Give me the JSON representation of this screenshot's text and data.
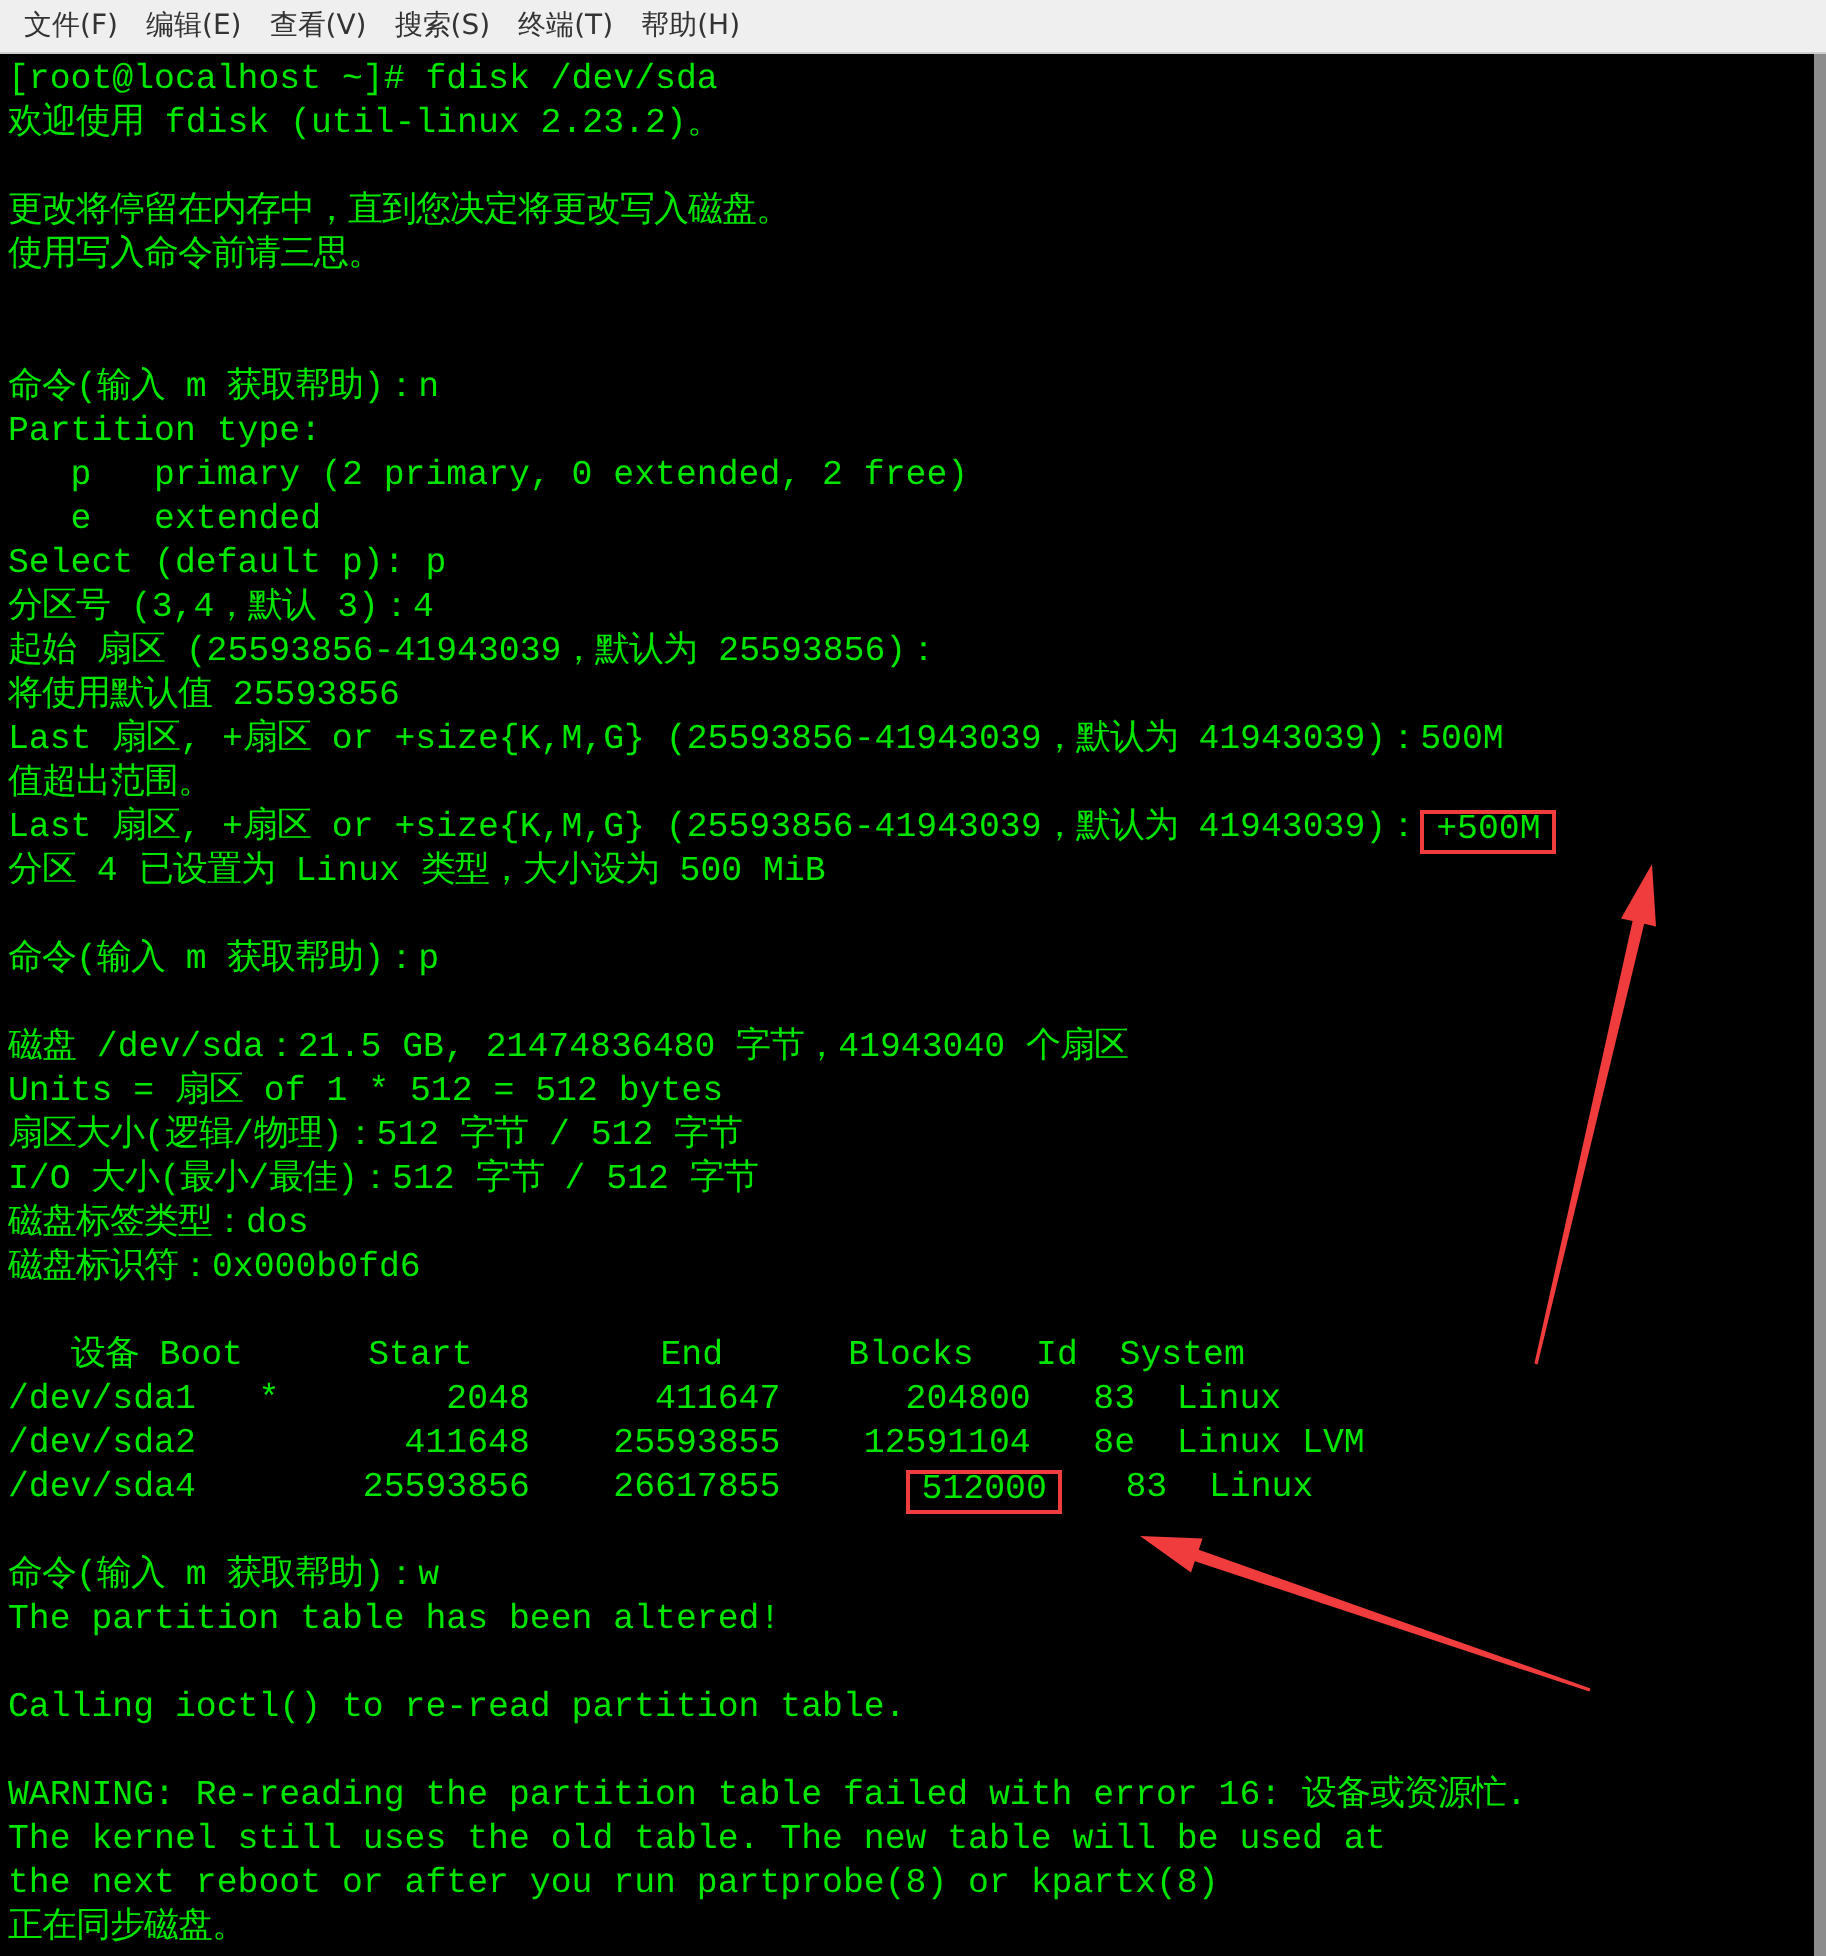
{
  "menu_bar": [
    "文件(F)",
    "编辑(E)",
    "查看(V)",
    "搜索(S)",
    "终端(T)",
    "帮助(H)"
  ],
  "terminal": {
    "lines": [
      {
        "kind": "text",
        "text": "[root@localhost ~]# fdisk /dev/sda"
      },
      {
        "kind": "text",
        "text": "欢迎使用 fdisk (util-linux 2.23.2)。"
      },
      {
        "kind": "blank"
      },
      {
        "kind": "text",
        "text": "更改将停留在内存中，直到您决定将更改写入磁盘。"
      },
      {
        "kind": "text",
        "text": "使用写入命令前请三思。"
      },
      {
        "kind": "blank"
      },
      {
        "kind": "blank"
      },
      {
        "kind": "text",
        "text": "命令(输入 m 获取帮助)：n"
      },
      {
        "kind": "text",
        "text": "Partition type:"
      },
      {
        "kind": "text",
        "text": "   p   primary (2 primary, 0 extended, 2 free)"
      },
      {
        "kind": "text",
        "text": "   e   extended"
      },
      {
        "kind": "text",
        "text": "Select (default p): p"
      },
      {
        "kind": "text",
        "text": "分区号 (3,4，默认 3)：4"
      },
      {
        "kind": "text",
        "text": "起始 扇区 (25593856-41943039，默认为 25593856)："
      },
      {
        "kind": "text",
        "text": "将使用默认值 25593856"
      },
      {
        "kind": "text",
        "text": "Last 扇区, +扇区 or +size{K,M,G} (25593856-41943039，默认为 41943039)：500M"
      },
      {
        "kind": "text",
        "text": "值超出范围。"
      },
      {
        "kind": "segmented",
        "segments": [
          {
            "text": "Last 扇区, +扇区 or +size{K,M,G} (25593856-41943039，默认为 41943039)：",
            "boxed": false
          },
          {
            "text": "+500M",
            "boxed": true
          }
        ]
      },
      {
        "kind": "text",
        "text": "分区 4 已设置为 Linux 类型，大小设为 500 MiB"
      },
      {
        "kind": "blank"
      },
      {
        "kind": "text",
        "text": "命令(输入 m 获取帮助)：p"
      },
      {
        "kind": "blank"
      },
      {
        "kind": "text",
        "text": "磁盘 /dev/sda：21.5 GB, 21474836480 字节，41943040 个扇区"
      },
      {
        "kind": "text",
        "text": "Units = 扇区 of 1 * 512 = 512 bytes"
      },
      {
        "kind": "text",
        "text": "扇区大小(逻辑/物理)：512 字节 / 512 字节"
      },
      {
        "kind": "text",
        "text": "I/O 大小(最小/最佳)：512 字节 / 512 字节"
      },
      {
        "kind": "text",
        "text": "磁盘标签类型：dos"
      },
      {
        "kind": "text",
        "text": "磁盘标识符：0x000b0fd6"
      },
      {
        "kind": "blank"
      },
      {
        "kind": "text",
        "text": "   设备 Boot      Start         End      Blocks   Id  System"
      },
      {
        "kind": "text",
        "text": "/dev/sda1   *        2048      411647      204800   83  Linux"
      },
      {
        "kind": "text",
        "text": "/dev/sda2          411648    25593855    12591104   8e  Linux LVM"
      },
      {
        "kind": "segmented",
        "segments": [
          {
            "text": "/dev/sda4        25593856    26617855      ",
            "boxed": false
          },
          {
            "text": "512000",
            "boxed": true
          },
          {
            "text": "   83  Linux",
            "boxed": false
          }
        ]
      },
      {
        "kind": "blank"
      },
      {
        "kind": "text",
        "text": "命令(输入 m 获取帮助)：w"
      },
      {
        "kind": "text",
        "text": "The partition table has been altered!"
      },
      {
        "kind": "blank"
      },
      {
        "kind": "text",
        "text": "Calling ioctl() to re-read partition table."
      },
      {
        "kind": "blank"
      },
      {
        "kind": "text",
        "text": "WARNING: Re-reading the partition table failed with error 16: 设备或资源忙."
      },
      {
        "kind": "text",
        "text": "The kernel still uses the old table. The new table will be used at"
      },
      {
        "kind": "text",
        "text": "the next reboot or after you run partprobe(8) or kpartx(8)"
      },
      {
        "kind": "text",
        "text": "正在同步磁盘。"
      }
    ]
  }
}
